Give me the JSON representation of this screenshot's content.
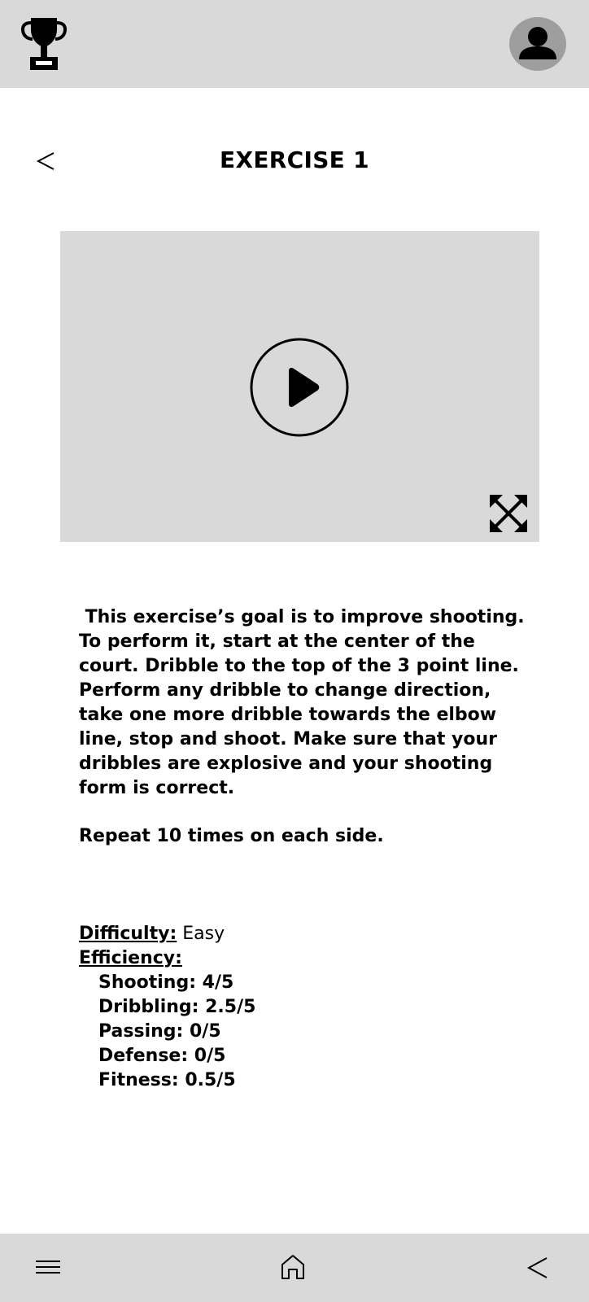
{
  "header": {
    "trophy_icon": "trophy-icon",
    "profile_icon": "user-avatar-icon"
  },
  "page": {
    "title": "EXERCISE 1",
    "back_icon": "chevron-left-icon"
  },
  "video": {
    "play_icon": "play-icon",
    "fullscreen_icon": "expand-icon"
  },
  "description": {
    "text": " This exercise’s goal is to improve shooting.  To perform it, start at the center of the court. Dribble to the top of the 3 point line. Perform any dribble to change direction, take one more dribble towards the elbow line, stop and shoot. Make sure that your dribbles are explosive and your shooting form is correct.",
    "repeat": "Repeat 10 times on each side."
  },
  "stats": {
    "difficulty_label": "Difficulty:",
    "difficulty_value": " Easy",
    "efficiency_label": "Efficiency:",
    "efficiency_items": [
      "Shooting: 4/5",
      "Dribbling: 2.5/5",
      "Passing: 0/5",
      "Defense: 0/5",
      "Fitness: 0.5/5"
    ]
  },
  "bottom_nav": {
    "menu_icon": "hamburger-menu-icon",
    "home_icon": "home-icon",
    "back_icon": "chevron-left-icon"
  },
  "colors": {
    "bar_background": "#d9d9d9",
    "video_background": "#d9d9d9",
    "avatar_background": "#9e9e9e"
  }
}
